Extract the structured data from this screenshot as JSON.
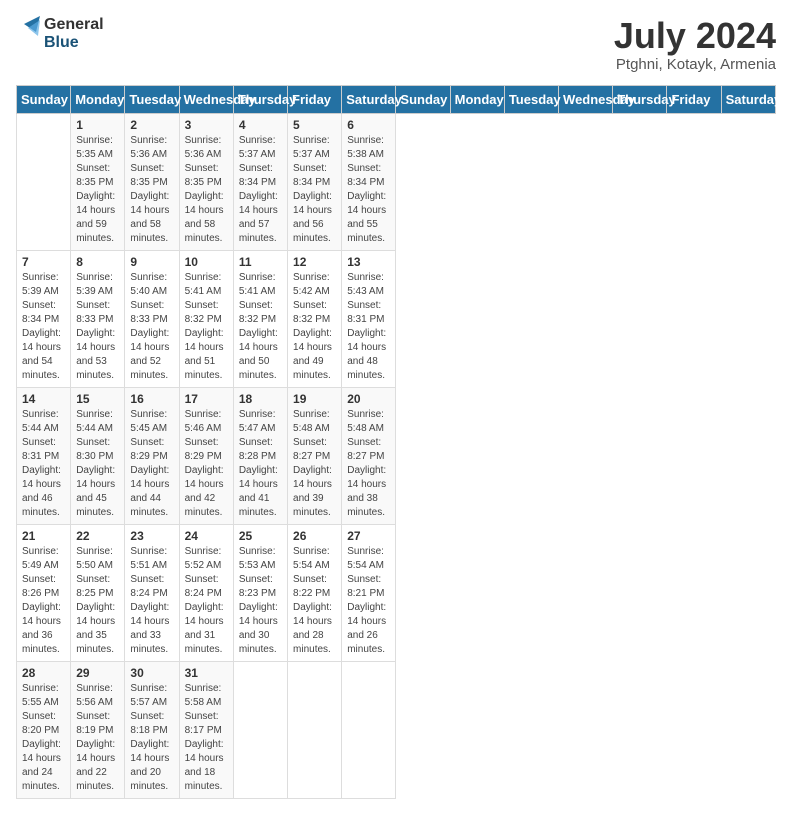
{
  "header": {
    "logo_general": "General",
    "logo_blue": "Blue",
    "month_year": "July 2024",
    "location": "Ptghni, Kotayk, Armenia"
  },
  "calendar": {
    "days_of_week": [
      "Sunday",
      "Monday",
      "Tuesday",
      "Wednesday",
      "Thursday",
      "Friday",
      "Saturday"
    ],
    "weeks": [
      [
        {
          "day": "",
          "content": ""
        },
        {
          "day": "1",
          "content": "Sunrise: 5:35 AM\nSunset: 8:35 PM\nDaylight: 14 hours\nand 59 minutes."
        },
        {
          "day": "2",
          "content": "Sunrise: 5:36 AM\nSunset: 8:35 PM\nDaylight: 14 hours\nand 58 minutes."
        },
        {
          "day": "3",
          "content": "Sunrise: 5:36 AM\nSunset: 8:35 PM\nDaylight: 14 hours\nand 58 minutes."
        },
        {
          "day": "4",
          "content": "Sunrise: 5:37 AM\nSunset: 8:34 PM\nDaylight: 14 hours\nand 57 minutes."
        },
        {
          "day": "5",
          "content": "Sunrise: 5:37 AM\nSunset: 8:34 PM\nDaylight: 14 hours\nand 56 minutes."
        },
        {
          "day": "6",
          "content": "Sunrise: 5:38 AM\nSunset: 8:34 PM\nDaylight: 14 hours\nand 55 minutes."
        }
      ],
      [
        {
          "day": "7",
          "content": "Sunrise: 5:39 AM\nSunset: 8:34 PM\nDaylight: 14 hours\nand 54 minutes."
        },
        {
          "day": "8",
          "content": "Sunrise: 5:39 AM\nSunset: 8:33 PM\nDaylight: 14 hours\nand 53 minutes."
        },
        {
          "day": "9",
          "content": "Sunrise: 5:40 AM\nSunset: 8:33 PM\nDaylight: 14 hours\nand 52 minutes."
        },
        {
          "day": "10",
          "content": "Sunrise: 5:41 AM\nSunset: 8:32 PM\nDaylight: 14 hours\nand 51 minutes."
        },
        {
          "day": "11",
          "content": "Sunrise: 5:41 AM\nSunset: 8:32 PM\nDaylight: 14 hours\nand 50 minutes."
        },
        {
          "day": "12",
          "content": "Sunrise: 5:42 AM\nSunset: 8:32 PM\nDaylight: 14 hours\nand 49 minutes."
        },
        {
          "day": "13",
          "content": "Sunrise: 5:43 AM\nSunset: 8:31 PM\nDaylight: 14 hours\nand 48 minutes."
        }
      ],
      [
        {
          "day": "14",
          "content": "Sunrise: 5:44 AM\nSunset: 8:31 PM\nDaylight: 14 hours\nand 46 minutes."
        },
        {
          "day": "15",
          "content": "Sunrise: 5:44 AM\nSunset: 8:30 PM\nDaylight: 14 hours\nand 45 minutes."
        },
        {
          "day": "16",
          "content": "Sunrise: 5:45 AM\nSunset: 8:29 PM\nDaylight: 14 hours\nand 44 minutes."
        },
        {
          "day": "17",
          "content": "Sunrise: 5:46 AM\nSunset: 8:29 PM\nDaylight: 14 hours\nand 42 minutes."
        },
        {
          "day": "18",
          "content": "Sunrise: 5:47 AM\nSunset: 8:28 PM\nDaylight: 14 hours\nand 41 minutes."
        },
        {
          "day": "19",
          "content": "Sunrise: 5:48 AM\nSunset: 8:27 PM\nDaylight: 14 hours\nand 39 minutes."
        },
        {
          "day": "20",
          "content": "Sunrise: 5:48 AM\nSunset: 8:27 PM\nDaylight: 14 hours\nand 38 minutes."
        }
      ],
      [
        {
          "day": "21",
          "content": "Sunrise: 5:49 AM\nSunset: 8:26 PM\nDaylight: 14 hours\nand 36 minutes."
        },
        {
          "day": "22",
          "content": "Sunrise: 5:50 AM\nSunset: 8:25 PM\nDaylight: 14 hours\nand 35 minutes."
        },
        {
          "day": "23",
          "content": "Sunrise: 5:51 AM\nSunset: 8:24 PM\nDaylight: 14 hours\nand 33 minutes."
        },
        {
          "day": "24",
          "content": "Sunrise: 5:52 AM\nSunset: 8:24 PM\nDaylight: 14 hours\nand 31 minutes."
        },
        {
          "day": "25",
          "content": "Sunrise: 5:53 AM\nSunset: 8:23 PM\nDaylight: 14 hours\nand 30 minutes."
        },
        {
          "day": "26",
          "content": "Sunrise: 5:54 AM\nSunset: 8:22 PM\nDaylight: 14 hours\nand 28 minutes."
        },
        {
          "day": "27",
          "content": "Sunrise: 5:54 AM\nSunset: 8:21 PM\nDaylight: 14 hours\nand 26 minutes."
        }
      ],
      [
        {
          "day": "28",
          "content": "Sunrise: 5:55 AM\nSunset: 8:20 PM\nDaylight: 14 hours\nand 24 minutes."
        },
        {
          "day": "29",
          "content": "Sunrise: 5:56 AM\nSunset: 8:19 PM\nDaylight: 14 hours\nand 22 minutes."
        },
        {
          "day": "30",
          "content": "Sunrise: 5:57 AM\nSunset: 8:18 PM\nDaylight: 14 hours\nand 20 minutes."
        },
        {
          "day": "31",
          "content": "Sunrise: 5:58 AM\nSunset: 8:17 PM\nDaylight: 14 hours\nand 18 minutes."
        },
        {
          "day": "",
          "content": ""
        },
        {
          "day": "",
          "content": ""
        },
        {
          "day": "",
          "content": ""
        }
      ]
    ]
  }
}
